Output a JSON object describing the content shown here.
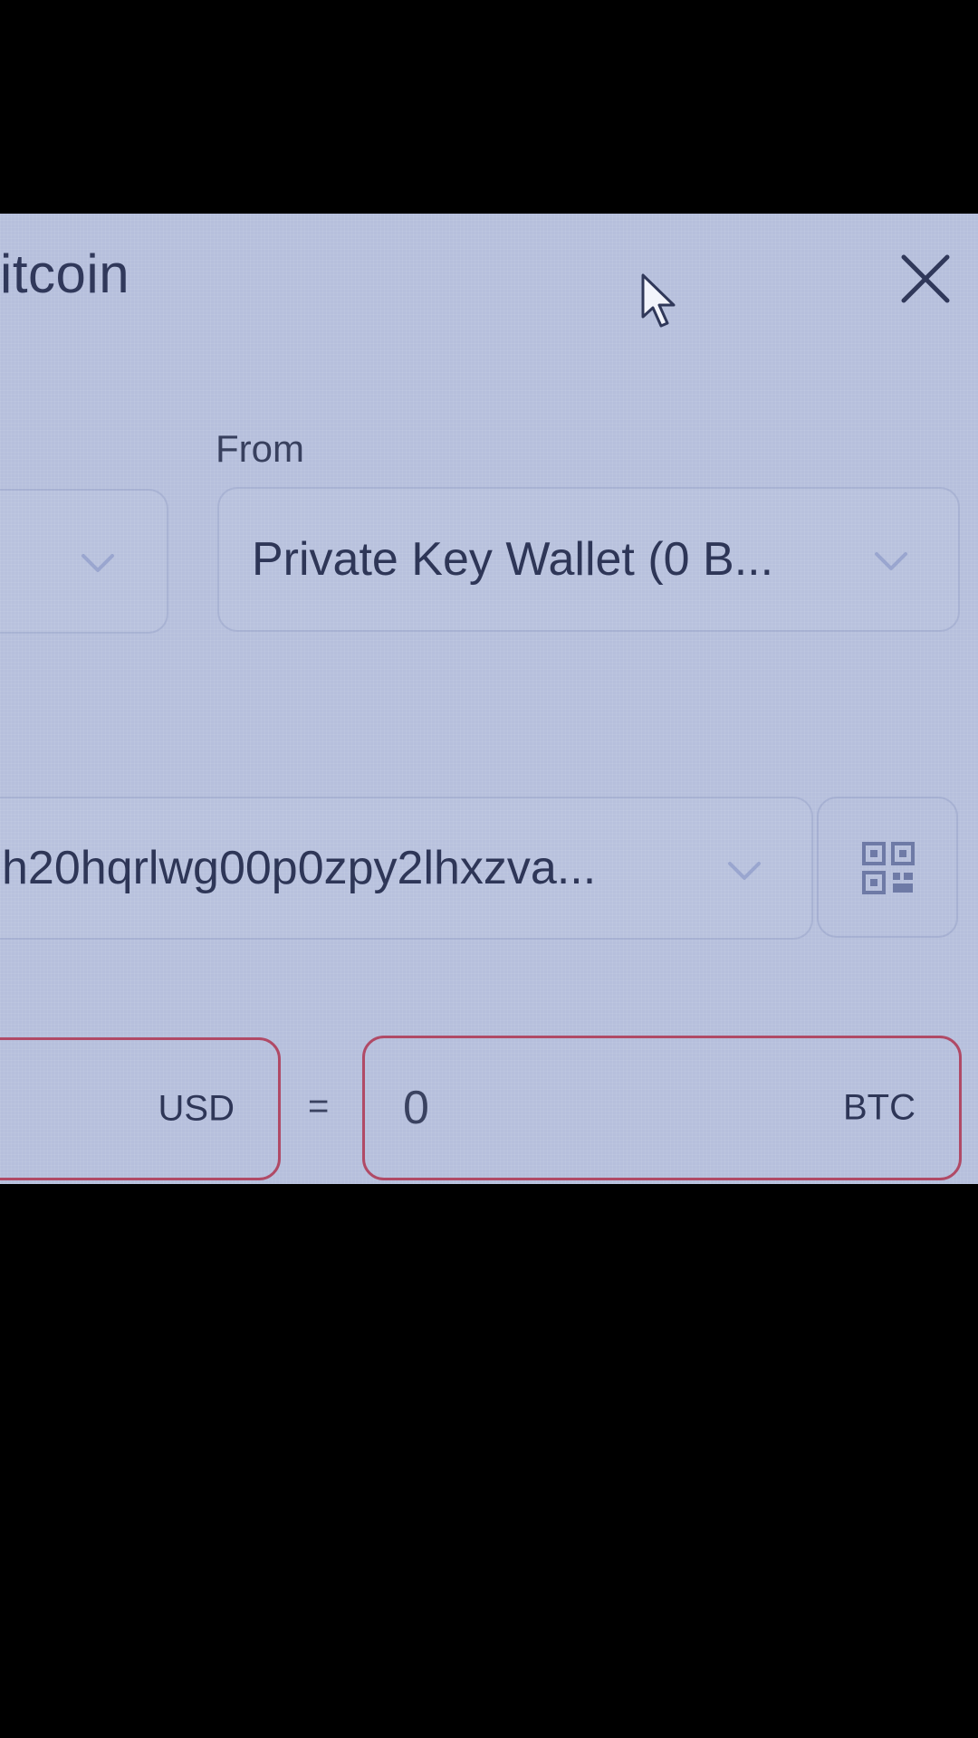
{
  "dialog": {
    "title": "itcoin"
  },
  "form": {
    "from_label": "From",
    "from_value": "Private Key Wallet (0 B...",
    "address_value": "h20hqrlwg00p0zpy2lhxzva...",
    "amount": {
      "usd_unit": "USD",
      "equals": "=",
      "btc_value": "0",
      "btc_unit": "BTC"
    }
  },
  "colors": {
    "screen_bg": "#b6bfdc",
    "text": "#2e3657",
    "error_border": "#b04a66"
  },
  "icons": [
    "close-icon",
    "mouse-cursor-icon",
    "chevron-down-icon",
    "qr-code-icon"
  ]
}
